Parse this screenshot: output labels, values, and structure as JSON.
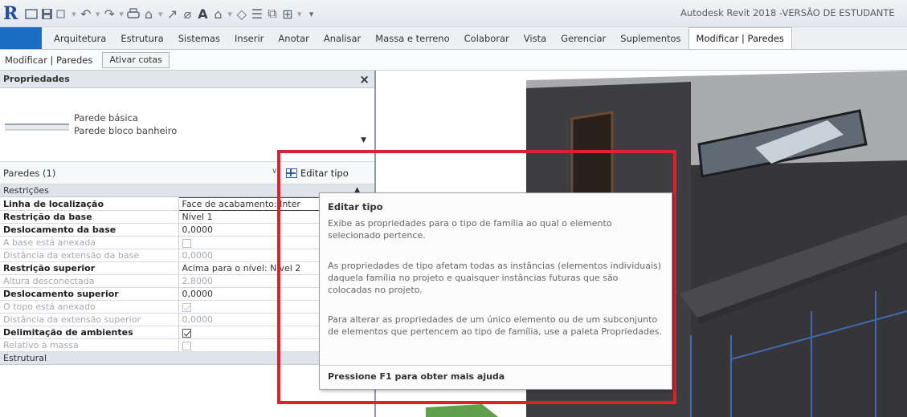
{
  "titlebar": {
    "app_title": "Autodesk Revit 2018 -VERSÃO DE ESTUDANTE",
    "qat_icons": [
      "revit-logo-icon",
      "open-icon",
      "save-icon",
      "sync-icon",
      "undo-icon",
      "redo-icon",
      "print-icon",
      "measure-icon",
      "dimension-icon",
      "tag-icon",
      "text-icon",
      "3d-view-icon",
      "section-icon",
      "thin-lines-icon",
      "close-hidden-icon",
      "switch-windows-icon",
      "customize-icon"
    ],
    "logo_letter": "R"
  },
  "ribbon": {
    "tabs": [
      "Arquitetura",
      "Estrutura",
      "Sistemas",
      "Inserir",
      "Anotar",
      "Analisar",
      "Massa e terreno",
      "Colaborar",
      "Vista",
      "Gerenciar",
      "Suplementos",
      "Modificar | Paredes"
    ],
    "active_tab": "Modificar | Paredes"
  },
  "options_bar": {
    "context": "Modificar | Paredes",
    "ativar_cotas": "Ativar cotas"
  },
  "properties": {
    "title": "Propriedades",
    "close": "×",
    "type_family": "Parede básica",
    "type_name": "Parede bloco banheiro",
    "dropdown": "▼",
    "instance_filter": "Paredes (1)",
    "edit_type_label": "Editar tipo",
    "groups": {
      "restricoes": "Restrições",
      "estrutural": "Estrutural"
    },
    "params": [
      {
        "name": "Linha de localização",
        "value": "Face de acabamento: Inter",
        "bold": true
      },
      {
        "name": "Restrição da base",
        "value": "Nível 1",
        "bold": true
      },
      {
        "name": "Deslocamento da base",
        "value": "0,0000",
        "bold": true
      },
      {
        "name": "A base está anexada",
        "value": "",
        "bold": false
      },
      {
        "name": "Distância da extensão da base",
        "value": "0,0000",
        "bold": false
      },
      {
        "name": "Restrição superior",
        "value": "Acima para o nível: Nível 2",
        "bold": true
      },
      {
        "name": "Altura desconectada",
        "value": "2,8000",
        "bold": false
      },
      {
        "name": "Deslocamento superior",
        "value": "0,0000",
        "bold": true
      },
      {
        "name": "O topo está anexado",
        "value": "",
        "bold": false
      },
      {
        "name": "Distância da extensão superior",
        "value": "0,0000",
        "bold": false
      },
      {
        "name": "Delimitação de ambientes",
        "value": "",
        "bold": true
      },
      {
        "name": "Relativo à massa",
        "value": "",
        "bold": false
      }
    ]
  },
  "tooltip": {
    "title": "Editar tipo",
    "p1": "Exibe as propriedades para o tipo de família ao qual o elemento selecionado pertence.",
    "p2": "As propriedades de tipo afetam todas as instâncias (elementos individuais) daquela família no projeto e quaisquer instâncias futuras que são colocadas no projeto.",
    "p3": "Para alterar as propriedades de um único elemento ou de um subconjunto de elementos que pertencem ao tipo de família, use a paleta Propriedades.",
    "help": "Pressione F1 para obter mais ajuda"
  },
  "colors": {
    "highlight": "#e0202c",
    "wall_dark": "#3e3e40",
    "wall_grey": "#a9abae",
    "roof": "#4a4a4d",
    "accent_blue": "#1a6ec1"
  }
}
